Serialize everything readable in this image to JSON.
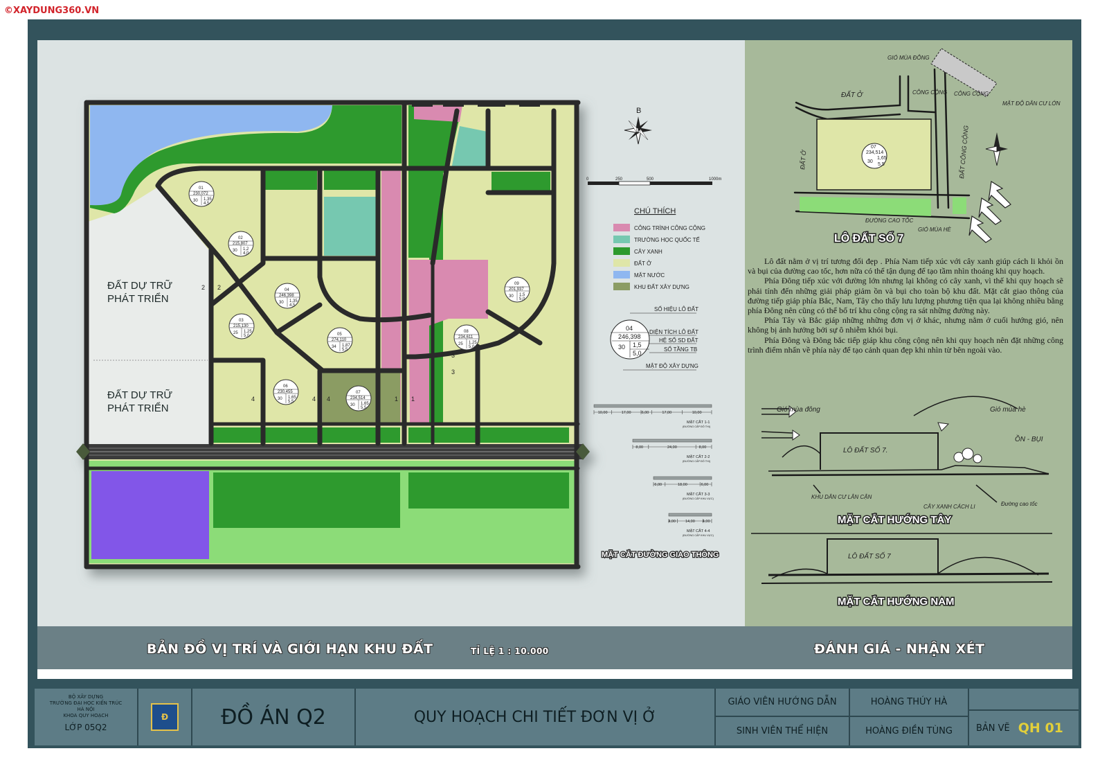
{
  "watermark": "©XAYDUNG360.VN",
  "map": {
    "reserve_label_1_line1": "ĐẤT DỰ TRỮ",
    "reserve_label_1_line2": "PHÁT TRIỂN",
    "reserve_label_2_line1": "ĐẤT DỰ TRỮ",
    "reserve_label_2_line2": "PHÁT TRIỂN",
    "lots": [
      {
        "no": "01",
        "area": "230,072",
        "k": "1,35",
        "p": "30",
        "f": "4,5"
      },
      {
        "no": "02",
        "area": "215,807",
        "k": "1,2",
        "p": "30",
        "f": "4,0"
      },
      {
        "no": "03",
        "area": "215,130",
        "k": "1,25",
        "p": "25",
        "f": "5,0"
      },
      {
        "no": "04",
        "area": "246,398",
        "k": "1,35",
        "p": "30",
        "f": "4,5"
      },
      {
        "no": "05",
        "area": "274,110",
        "k": "1,87",
        "p": "34",
        "f": "5,5"
      },
      {
        "no": "06",
        "area": "230,455",
        "k": "1,65",
        "p": "30",
        "f": "5,5"
      },
      {
        "no": "07",
        "area": "234,514",
        "k": "1,65",
        "p": "30",
        "f": "5,5"
      },
      {
        "no": "08",
        "area": "234,611",
        "k": "1,25",
        "p": "25",
        "f": "5,0"
      },
      {
        "no": "09",
        "area": "201,937",
        "k": "1,5",
        "p": "30",
        "f": "5,0"
      }
    ],
    "road_marks": [
      "2",
      "2",
      "4",
      "4",
      "4",
      "1",
      "1",
      "3",
      "3"
    ],
    "north": "B",
    "scale_ticks": [
      "0",
      "250",
      "500",
      "1000m"
    ]
  },
  "legend": {
    "title": "CHÚ THÍCH",
    "items": [
      {
        "label": "CÔNG TRÌNH CÔNG CỘNG",
        "color": "#d98ab0"
      },
      {
        "label": "TRƯỜNG HỌC QUỐC TẾ",
        "color": "#76c8b0"
      },
      {
        "label": "CÂY XANH",
        "color": "#2d9a2d"
      },
      {
        "label": "ĐẤT Ở",
        "color": "#dfe6a8"
      },
      {
        "label": "MẶT NƯỚC",
        "color": "#8fb7f0"
      },
      {
        "label": "KHU ĐẤT XÂY DỰNG",
        "color": "#8b9c64"
      }
    ],
    "key_title": "SỐ HIỆU LÔ ĐẤT",
    "key_no": "04",
    "key_area": "246,398",
    "key_k": "1,5",
    "key_p": "30",
    "key_f": "5,0",
    "key_area_label": "DIỆN TÍCH LÔ ĐẤT",
    "key_k_label": "HỆ SỐ SD ĐẤT",
    "key_f_label": "SỐ TẦNG TB",
    "key_p_label": "MẬT ĐỘ XÂY DỰNG"
  },
  "sections": {
    "title": "MẶT CẮT ĐƯỜNG GIAO THÔNG",
    "items": [
      {
        "name": "MẶT CẮT 1-1",
        "sub": "(ĐƯỜNG CẤP ĐÔ THỊ)",
        "dims": [
          "10,00",
          "17,00",
          "6,00",
          "17,00",
          "10,00"
        ]
      },
      {
        "name": "MẶT CẮT 2-2",
        "sub": "(ĐƯỜNG CẤP ĐÔ THỊ)",
        "dims": [
          "8,00",
          "24,00",
          "8,00"
        ]
      },
      {
        "name": "MẶT CẮT 3-3",
        "sub": "(ĐƯỜNG CẤP KHU VỰC)",
        "dims": [
          "6,00",
          "18,00",
          "6,00"
        ]
      },
      {
        "name": "MẶT CẮT 4-4",
        "sub": "(ĐƯỜNG CẤP KHU VỰC)",
        "dims": [
          "4,00",
          "14,00",
          "4,00"
        ]
      }
    ]
  },
  "sketch": {
    "wind_winter": "GIÓ MÙA ĐÔNG",
    "wind_summer": "GIÓ MÙA HÈ",
    "land": "ĐẤT Ở",
    "land_w": "ĐẤT Ở",
    "public1": "CÔNG CỘNG",
    "public2": "CÔNG CỘNG",
    "public3": "ĐẤT CÔNG CỘNG",
    "dense": "MẶT ĐỘ DÂN CƯ LỚN",
    "highway": "ĐƯỜNG CAO TỐC",
    "lot_label": "07",
    "lot_area": "234,514",
    "lot_k": "1,65",
    "lot_p": "30",
    "lot_f": "5,5",
    "title": "LÔ ĐẤT SỐ 7"
  },
  "notes": [
    "Lô đất nằm ở vị trí tương đối đẹp . Phía Nam tiếp xúc với cây xanh giúp cách li khỏi ồn và bụi của đường cao tốc, hơn nữa có thể tận dụng để tạo tầm nhìn thoáng khi quy hoạch.",
    "Phía Đông tiếp xúc với đường lớn nhưng lại không có cây xanh, vì thế khi quy hoạch sẽ phải tính đến những giải pháp giảm ồn và bụi cho toàn bộ khu đất. Mặt cắt giao thông  của đường tiếp giáp phía Bắc, Nam, Tây cho thấy lưu lượng phương tiện qua lại không nhiều bằng phía Đông nên cũng có thể bố trí khu công cộng ra sát những đường này.",
    "Phía Tây và Bắc giáp những những đơn vị ở khác, nhưng nằm ở cuối hướng gió, nên không bị ảnh hưởng bởi sự ô nhiễm khói bụi.",
    "Phía Đông và Đông bắc tiếp giáp khu công cộng nên khi quy hoạch nên đặt những công trình điểm nhấn về phía này  để tạo cảnh quan đẹp khi nhìn từ bên ngoài vào."
  ],
  "west_section": {
    "wind_winter": "Gió mùa đông",
    "wind_summer": "Gió mùa hè",
    "noise": "ỒN - BỤI",
    "lot": "LÔ ĐẤT SỐ 7.",
    "neighbour": "KHU DÂN CƯ LÂN CẬN",
    "trees": "CÂY XANH CÁCH LI",
    "highway": "Đường cao tốc",
    "title": "MẶT CẮT HƯỚNG TÂY"
  },
  "south_section": {
    "lot": "LÔ ĐẤT SỐ 7",
    "title": "MẶT CẮT HƯỚNG NAM"
  },
  "banner": {
    "left_title": "BẢN ĐỒ VỊ TRÍ VÀ GIỚI HẠN KHU ĐẤT",
    "scale": "TỈ LỆ  1 : 10.000",
    "right_title": "ĐÁNH GIÁ - NHẬN XÉT"
  },
  "title_block": {
    "org_line1": "BỘ XÂY DỰNG",
    "org_line2": "TRƯỜNG ĐẠI HỌC KIẾN TRÚC",
    "org_line3": "HÀ NỘI",
    "org_line4": "KHOA QUY HOẠCH",
    "class": "LỚP 05Q2",
    "project": "ĐỒ ÁN Q2",
    "subject": "QUY HOẠCH CHI TIẾT ĐƠN VỊ Ở",
    "instructor_label": "GIÁO VIÊN HƯỚNG DẪN",
    "instructor": "HOÀNG THÚY HÀ",
    "student_label": "SINH VIÊN THỂ HIỆN",
    "student": "HOÀNG ĐIỀN TÙNG",
    "sheet_label": "BẢN VẼ",
    "sheet_no": "QH 01"
  }
}
